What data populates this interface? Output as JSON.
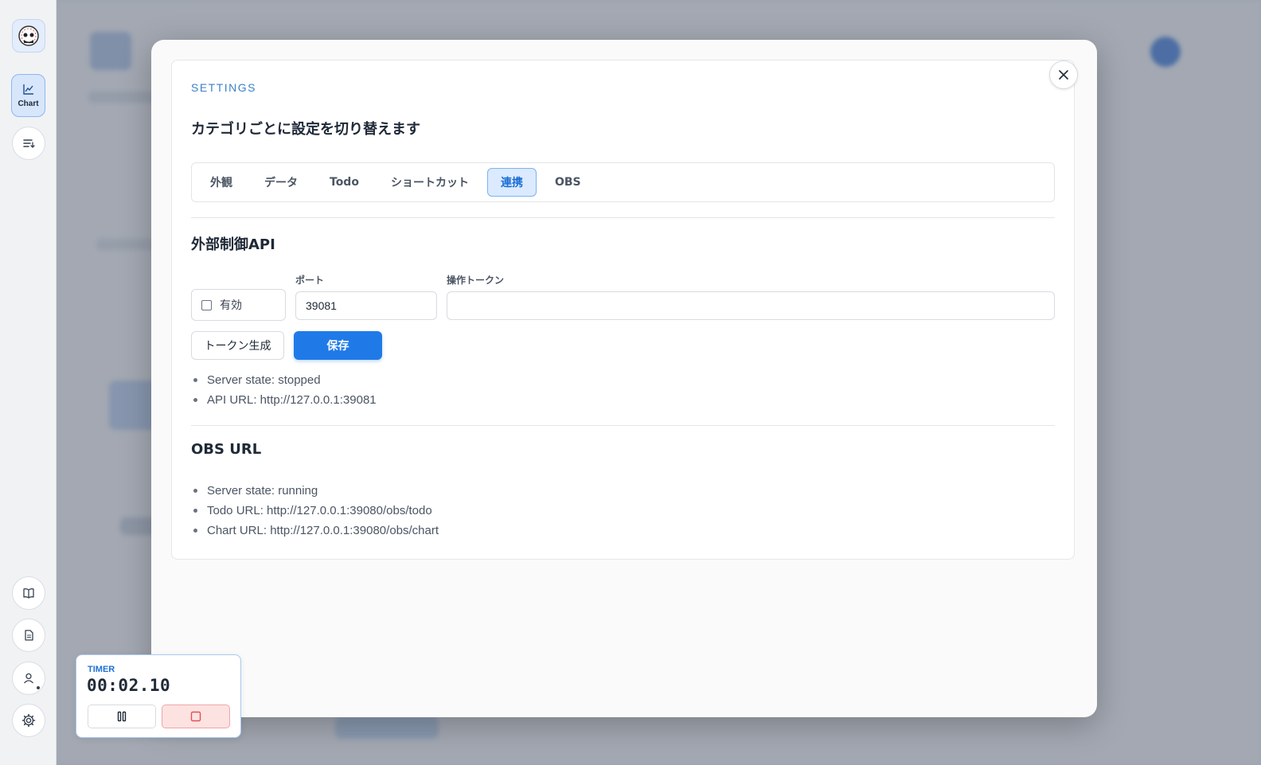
{
  "rail": {
    "chart_label": "Chart"
  },
  "settings": {
    "eyebrow": "SETTINGS",
    "subtitle": "カテゴリごとに設定を切り替えます",
    "tabs": [
      {
        "label": "外観"
      },
      {
        "label": "データ"
      },
      {
        "label": "Todo"
      },
      {
        "label": "ショートカット"
      },
      {
        "label": "連携",
        "active": true
      },
      {
        "label": "OBS"
      }
    ],
    "api": {
      "heading": "外部制御API",
      "enabled_label": "有効",
      "enabled": false,
      "port_label": "ポート",
      "port_value": "39081",
      "token_label": "操作トークン",
      "token_value": "",
      "generate_label": "トークン生成",
      "save_label": "保存",
      "info": [
        "Server state: stopped",
        "API URL: http://127.0.0.1:39081"
      ]
    },
    "obs": {
      "heading": "OBS URL",
      "info": [
        "Server state: running",
        "Todo URL: http://127.0.0.1:39080/obs/todo",
        "Chart URL: http://127.0.0.1:39080/obs/chart"
      ]
    }
  },
  "timer": {
    "label": "TIMER",
    "value": "00:02.10"
  },
  "colors": {
    "accent": "#1f7ae8",
    "accent_light": "#dbeafe",
    "stop": "#fde2e2"
  }
}
